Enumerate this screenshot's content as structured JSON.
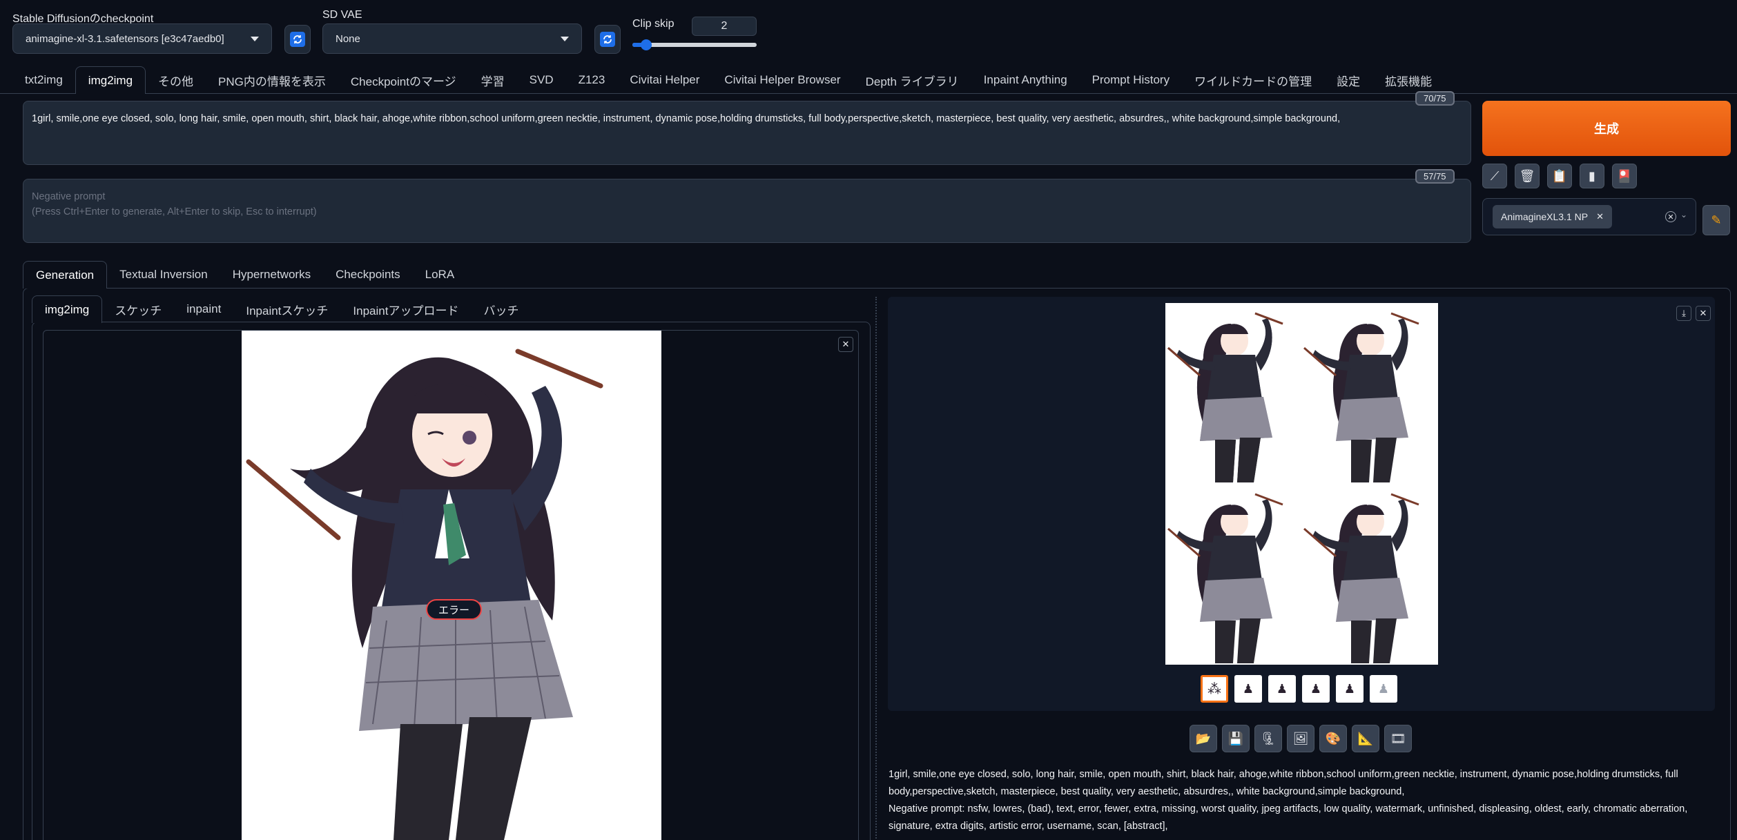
{
  "top": {
    "checkpoint_label": "Stable Diffusionのcheckpoint",
    "checkpoint_value": "animagine-xl-3.1.safetensors [e3c47aedb0]",
    "vae_label": "SD VAE",
    "vae_value": "None",
    "clip_skip_label": "Clip skip",
    "clip_skip_value": "2",
    "clip_skip_fraction": 0.09
  },
  "main_tabs": [
    "txt2img",
    "img2img",
    "その他",
    "PNG内の情報を表示",
    "Checkpointのマージ",
    "学習",
    "SVD",
    "Z123",
    "Civitai Helper",
    "Civitai Helper Browser",
    "Depth ライブラリ",
    "Inpaint Anything",
    "Prompt History",
    "ワイルドカードの管理",
    "設定",
    "拡張機能"
  ],
  "prompt": {
    "text": "1girl, smile,one eye closed, solo, long hair, smile, open mouth, shirt, black hair, ahoge,white ribbon,school uniform,green necktie, instrument, dynamic pose,holding drumsticks, full body,perspective,sketch,  masterpiece, best quality, very aesthetic, absurdres,, white background,simple background,",
    "counter": "70/75"
  },
  "negative": {
    "placeholder_line1": "Negative prompt",
    "placeholder_line2": "(Press Ctrl+Enter to generate, Alt+Enter to skip, Esc to interrupt)",
    "counter": "57/75"
  },
  "generate_label": "生成",
  "tool_icons": [
    "pencil-icon",
    "trash-icon",
    "clipboard-icon",
    "battery-icon",
    "palette-icon"
  ],
  "style_chip": "AnimagineXL3.1 NP",
  "extra_tabs": [
    "Generation",
    "Textual Inversion",
    "Hypernetworks",
    "Checkpoints",
    "LoRA"
  ],
  "img_tabs": [
    "img2img",
    "スケッチ",
    "inpaint",
    "Inpaintスケッチ",
    "Inpaintアップロード",
    "バッチ"
  ],
  "error_badge": "エラー",
  "close_glyph": "✕",
  "output_tools": [
    "folder-icon",
    "save-icon",
    "zip-icon",
    "image-icon",
    "palette-icon",
    "ruler-icon",
    "film-icon"
  ],
  "info": {
    "positive": "1girl, smile,one eye closed, solo, long hair, smile, open mouth, shirt, black hair, ahoge,white ribbon,school uniform,green necktie, instrument, dynamic pose,holding drumsticks, full body,perspective,sketch, masterpiece, best quality, very aesthetic, absurdres,, white background,simple background,",
    "negative": "Negative prompt: nsfw, lowres, (bad), text, error, fewer, extra, missing, worst quality, jpeg artifacts, low quality, watermark, unfinished, displeasing, oldest, early, chromatic aberration, signature, extra digits, artistic error, username, scan, [abstract],"
  },
  "colors": {
    "accent": "#f26a1b",
    "bg": "#0b0f19",
    "panel": "#1f2937"
  }
}
